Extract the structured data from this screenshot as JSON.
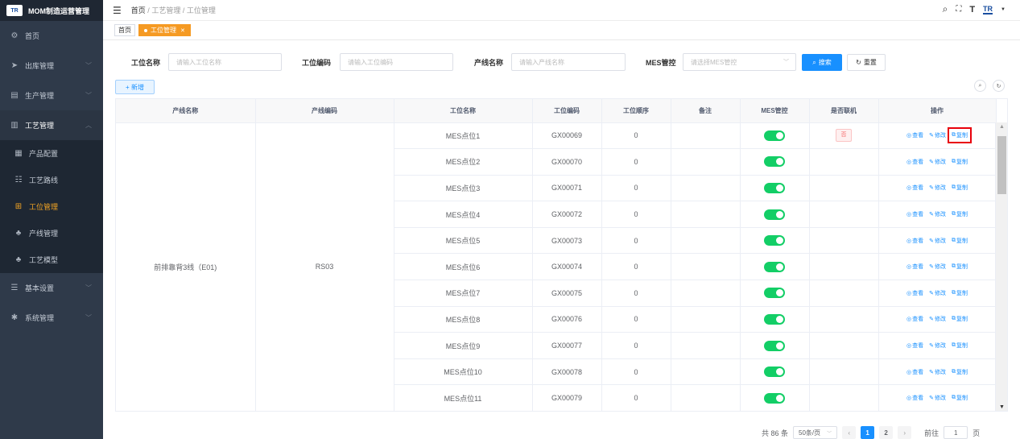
{
  "app": {
    "title": "MOM制造运营管理",
    "logo_text": "TR"
  },
  "sidebar": {
    "items": [
      {
        "label": "首页",
        "icon": "dashboard-icon"
      },
      {
        "label": "出库管理",
        "icon": "send-icon"
      },
      {
        "label": "生产管理",
        "icon": "production-icon"
      },
      {
        "label": "工艺管理",
        "icon": "process-icon"
      }
    ],
    "submenu": [
      {
        "label": "产品配置",
        "icon": "product-icon"
      },
      {
        "label": "工艺路线",
        "icon": "route-icon"
      },
      {
        "label": "工位管理",
        "icon": "station-icon",
        "active": true
      },
      {
        "label": "产线管理",
        "icon": "line-icon"
      },
      {
        "label": "工艺模型",
        "icon": "model-icon"
      }
    ],
    "bottom_items": [
      {
        "label": "基本设置",
        "icon": "settings-icon"
      },
      {
        "label": "系统管理",
        "icon": "gear-icon"
      }
    ]
  },
  "header": {
    "breadcrumb": [
      "首页",
      "工艺管理",
      "工位管理"
    ],
    "brand_logo": "TR"
  },
  "tags": {
    "home": "首页",
    "active": "工位管理"
  },
  "search": {
    "station_name_label": "工位名称",
    "station_name_placeholder": "请输入工位名称",
    "station_code_label": "工位编码",
    "station_code_placeholder": "请输入工位编码",
    "line_name_label": "产线名称",
    "line_name_placeholder": "请输入产线名称",
    "mes_label": "MES管控",
    "mes_placeholder": "请选择MES管控",
    "search_button": "搜索",
    "reset_button": "重置"
  },
  "toolbar": {
    "add_button": "+ 新增"
  },
  "table": {
    "columns": [
      "产线名称",
      "产线编码",
      "工位名称",
      "工位编码",
      "工位顺序",
      "备注",
      "MES管控",
      "是否联机",
      "操作"
    ],
    "merged_line_name": "前排靠背3线（E01)",
    "merged_line_code": "RS03",
    "rows": [
      {
        "station_name": "MES点位1",
        "station_code": "GX00069",
        "order": "0",
        "remark": "",
        "online": "否"
      },
      {
        "station_name": "MES点位2",
        "station_code": "GX00070",
        "order": "0",
        "remark": "",
        "online": ""
      },
      {
        "station_name": "MES点位3",
        "station_code": "GX00071",
        "order": "0",
        "remark": "",
        "online": ""
      },
      {
        "station_name": "MES点位4",
        "station_code": "GX00072",
        "order": "0",
        "remark": "",
        "online": ""
      },
      {
        "station_name": "MES点位5",
        "station_code": "GX00073",
        "order": "0",
        "remark": "",
        "online": ""
      },
      {
        "station_name": "MES点位6",
        "station_code": "GX00074",
        "order": "0",
        "remark": "",
        "online": ""
      },
      {
        "station_name": "MES点位7",
        "station_code": "GX00075",
        "order": "0",
        "remark": "",
        "online": ""
      },
      {
        "station_name": "MES点位8",
        "station_code": "GX00076",
        "order": "0",
        "remark": "",
        "online": ""
      },
      {
        "station_name": "MES点位9",
        "station_code": "GX00077",
        "order": "0",
        "remark": "",
        "online": ""
      },
      {
        "station_name": "MES点位10",
        "station_code": "GX00078",
        "order": "0",
        "remark": "",
        "online": ""
      },
      {
        "station_name": "MES点位11",
        "station_code": "GX00079",
        "order": "0",
        "remark": "",
        "online": ""
      }
    ],
    "ops": {
      "view": "查看",
      "edit": "修改",
      "copy": "复制"
    }
  },
  "pagination": {
    "total": "共 86 条",
    "page_size": "50条/页",
    "pages": [
      "1",
      "2"
    ],
    "goto_label": "前往",
    "goto_value": "1",
    "page_suffix": "页"
  },
  "colors": {
    "accent": "#1890ff",
    "active_tab": "#f59a23",
    "switch_on": "#13ce66",
    "highlight": "#e8000b"
  }
}
